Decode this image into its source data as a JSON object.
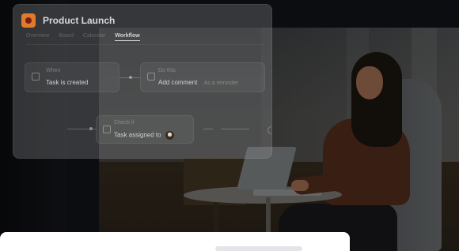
{
  "app": {
    "title": "Product Launch"
  },
  "tabs": [
    {
      "label": "Overview"
    },
    {
      "label": "Board"
    },
    {
      "label": "Calendar"
    },
    {
      "label": "Workflow",
      "active": true
    }
  ],
  "workflow": {
    "when": {
      "label": "When",
      "text": "Task is created"
    },
    "do_this": {
      "label": "Do this",
      "text": "Add comment",
      "sub": "As a reminder"
    },
    "check_if": {
      "label": "Check if",
      "text": "Task assigned to"
    }
  },
  "colors": {
    "accent": "#e07a2d",
    "card_bg": "#96989c",
    "text_primary": "#d6d7da"
  }
}
